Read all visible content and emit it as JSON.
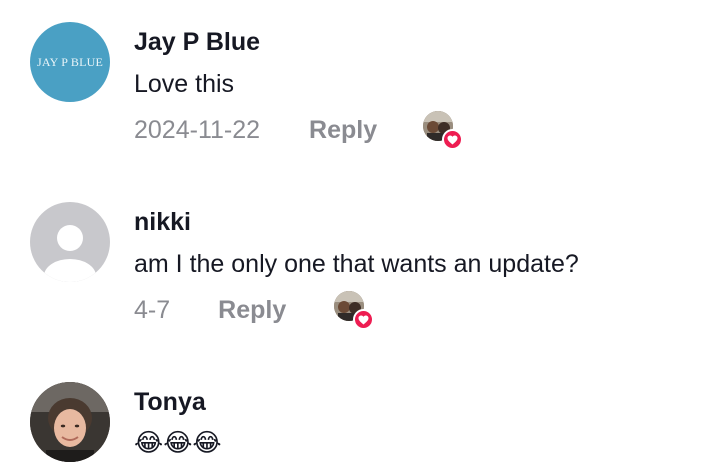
{
  "comments": [
    {
      "username": "Jay P Blue",
      "avatar_text": "JAY P BLUE",
      "text": "Love this",
      "date": "2024-11-22",
      "reply_label": "Reply",
      "liked_by_creator": true
    },
    {
      "username": "nikki",
      "avatar": "default-profile-icon",
      "text": "am I the only one that wants an update?",
      "date": "4-7",
      "reply_label": "Reply",
      "liked_by_creator": true
    },
    {
      "username": "Tonya",
      "avatar": "user-photo",
      "text": "😂😂😂"
    }
  ],
  "colors": {
    "heart": "#ee1d52",
    "muted_text": "#8a8b91",
    "avatar_blue": "#4aa0c4",
    "avatar_default": "#c8c8cc"
  }
}
